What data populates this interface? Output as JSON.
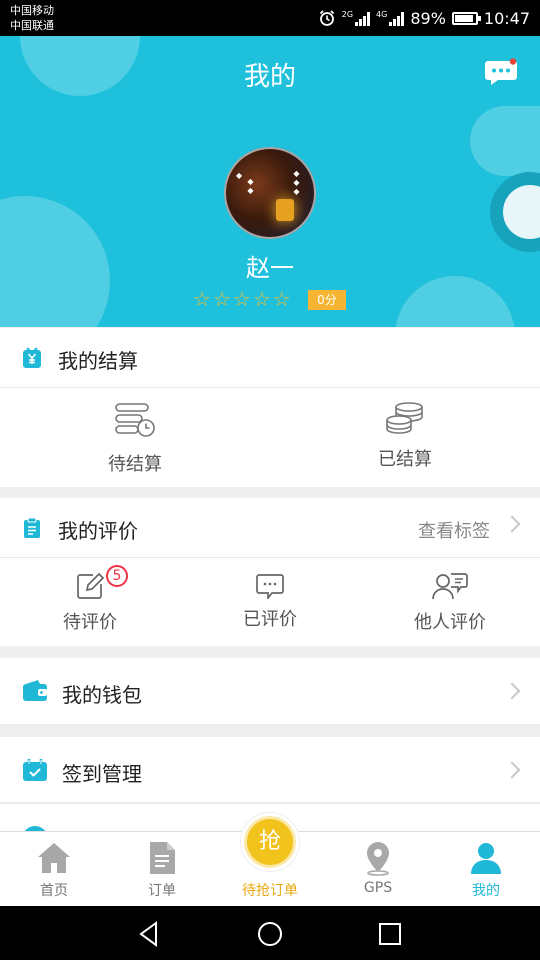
{
  "status_bar": {
    "carrier_1": "中国移动",
    "carrier_2": "中国联通",
    "net_1": "2G",
    "net_2": "4G",
    "battery": "89%",
    "time": "10:47"
  },
  "header": {
    "title": "我的",
    "user_name": "赵一",
    "rating_stars": 0,
    "score": "0分",
    "accent_color": "#1fc0dc"
  },
  "settlement": {
    "title": "我的结算",
    "items": [
      {
        "label": "待结算",
        "icon": "list-clock-icon"
      },
      {
        "label": "已结算",
        "icon": "coins-stack-icon"
      }
    ]
  },
  "reviews": {
    "title": "我的评价",
    "view_tags": "查看标签",
    "items": [
      {
        "label": "待评价",
        "icon": "edit-icon",
        "badge": "5"
      },
      {
        "label": "已评价",
        "icon": "chat-bubble-icon"
      },
      {
        "label": "他人评价",
        "icon": "person-chat-icon"
      }
    ]
  },
  "wallet": {
    "label": "我的钱包",
    "icon": "wallet-icon"
  },
  "checkin": {
    "label": "签到管理",
    "icon": "calendar-check-icon"
  },
  "tabbar": {
    "tabs": [
      {
        "label": "首页",
        "icon": "home-icon"
      },
      {
        "label": "订单",
        "icon": "document-icon"
      },
      {
        "label": "待抢订单",
        "icon": "grab-icon",
        "glyph": "抢"
      },
      {
        "label": "GPS",
        "icon": "location-pin-icon"
      },
      {
        "label": "我的",
        "icon": "user-icon",
        "active": true
      }
    ]
  },
  "navbar": {
    "buttons": [
      "back-icon",
      "home-circle-icon",
      "recent-apps-icon"
    ]
  }
}
